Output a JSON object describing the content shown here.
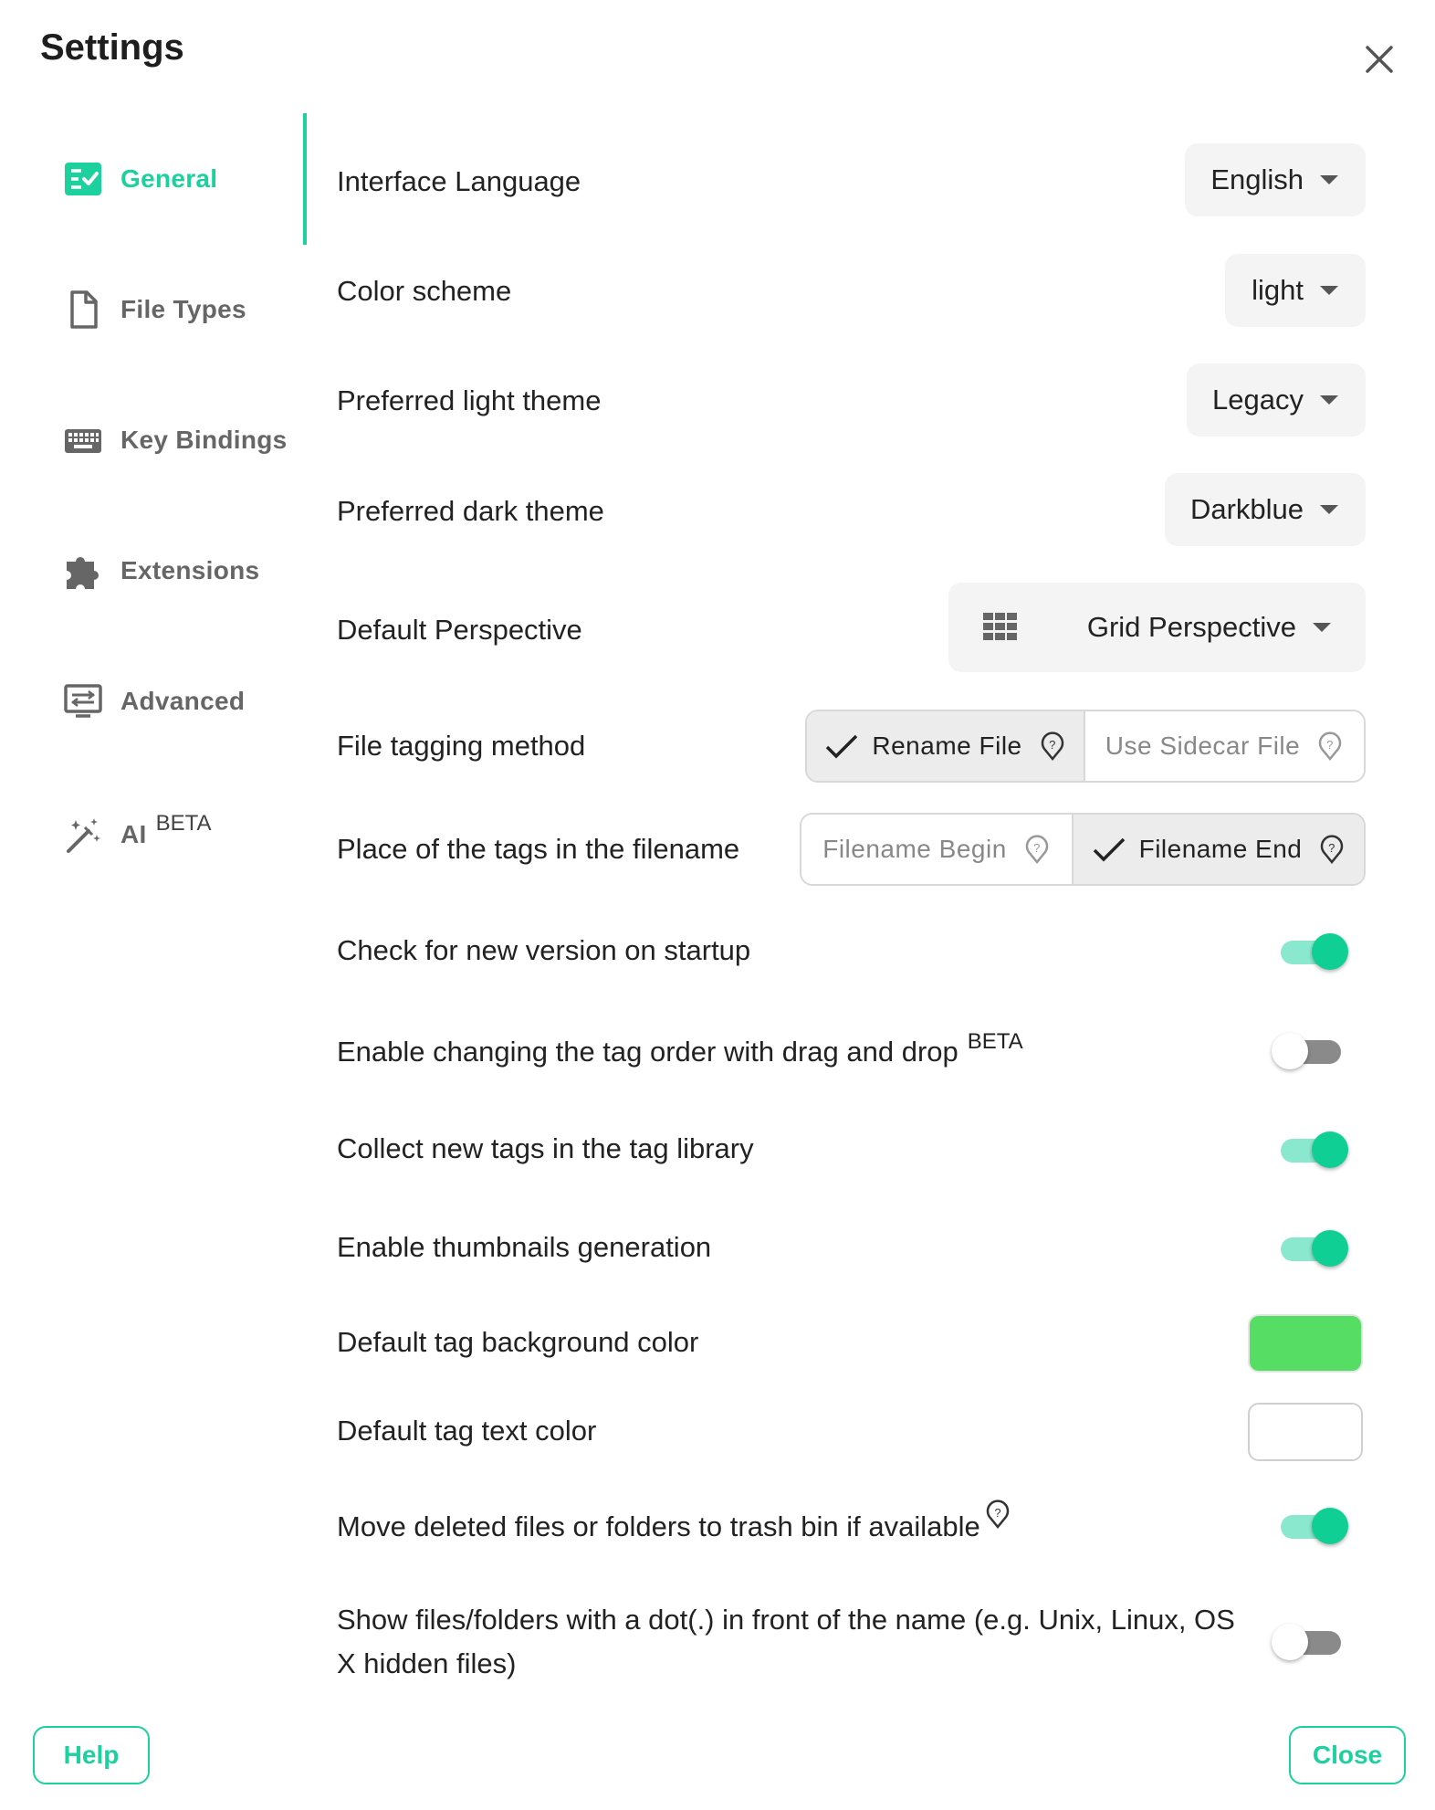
{
  "dialog": {
    "title": "Settings"
  },
  "sidebar": {
    "items": [
      {
        "label": "General",
        "icon": "general-checklist-icon",
        "active": true
      },
      {
        "label": "File Types",
        "icon": "file-icon"
      },
      {
        "label": "Key Bindings",
        "icon": "keyboard-icon"
      },
      {
        "label": "Extensions",
        "icon": "puzzle-icon"
      },
      {
        "label": "Advanced",
        "icon": "advanced-settings-icon"
      },
      {
        "label": "AI",
        "icon": "magic-wand-icon",
        "badge": "BETA"
      }
    ]
  },
  "general": {
    "interface_language": {
      "label": "Interface Language",
      "value": "English"
    },
    "color_scheme": {
      "label": "Color scheme",
      "value": "light"
    },
    "light_theme": {
      "label": "Preferred light theme",
      "value": "Legacy"
    },
    "dark_theme": {
      "label": "Preferred dark theme",
      "value": "Darkblue"
    },
    "default_perspective": {
      "label": "Default Perspective",
      "value": "Grid Perspective",
      "icon": "grid-icon"
    },
    "tagging_method": {
      "label": "File tagging method",
      "options": [
        "Rename File",
        "Use Sidecar File"
      ],
      "selected": "Rename File"
    },
    "tag_placement": {
      "label": "Place of the tags in the filename",
      "options": [
        "Filename Begin",
        "Filename End"
      ],
      "selected": "Filename End"
    },
    "check_new_version": {
      "label": "Check for new version on startup",
      "enabled": true
    },
    "drag_drop_tag_order": {
      "label": "Enable changing the tag order with drag and drop",
      "badge": "BETA",
      "enabled": false
    },
    "collect_new_tags": {
      "label": "Collect new tags in the tag library",
      "enabled": true
    },
    "thumbnails": {
      "label": "Enable thumbnails generation",
      "enabled": true
    },
    "tag_bg_color": {
      "label": "Default tag background color",
      "color": "#55de63"
    },
    "tag_text_color": {
      "label": "Default tag text color",
      "color": "#ffffff"
    },
    "trash_bin": {
      "label": "Move deleted files or folders to trash bin if available",
      "enabled": true
    },
    "hidden_files": {
      "label": "Show files/folders with a dot(.) in front of the name (e.g. Unix, Linux, OS X hidden files)",
      "enabled": false
    }
  },
  "footer": {
    "help_label": "Help",
    "close_label": "Close"
  },
  "colors": {
    "accent": "#1dd19f",
    "switch_on": "#10cf95"
  }
}
